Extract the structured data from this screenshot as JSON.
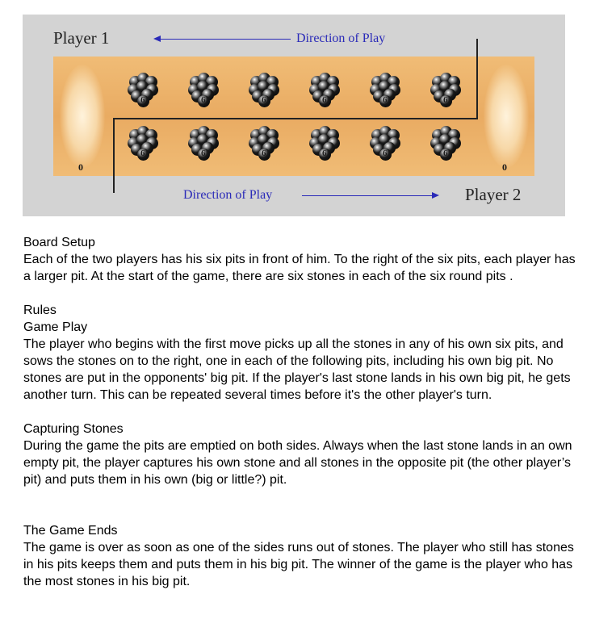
{
  "board": {
    "player1_label": "Player 1",
    "player2_label": "Player 2",
    "direction_top": "Direction of Play",
    "direction_bottom": "Direction of Play",
    "top_row_counts": [
      "6",
      "6",
      "6",
      "6",
      "6",
      "6"
    ],
    "bottom_row_counts": [
      "6",
      "6",
      "6",
      "6",
      "6",
      "6"
    ],
    "left_store_count": "0",
    "right_store_count": "0",
    "colors": {
      "panel": "#d3d3d3",
      "wood": "#e9ab62",
      "arrow": "#2a2ab8",
      "stone": "#000000"
    }
  },
  "rules": {
    "board_setup_title": "Board Setup",
    "board_setup_text": "Each of the two players has his six pits in front of him. To the right of the six pits, each player has a larger pit. At the start of the game, there are six stones in each of the six round pits .",
    "rules_title": "Rules",
    "game_play_title": "Game Play",
    "game_play_text": "The player who begins with the first move picks up all the stones in any of his own six pits, and sows the stones on to the right, one in each of the following pits, including his own big pit. No stones are put in the opponents' big pit. If the player's last stone lands in his own big pit, he gets another turn. This can be repeated several times before it's the other player's turn.",
    "capturing_title": "Capturing Stones",
    "capturing_text": "During the game the pits are emptied on both sides. Always when the last stone lands in an own empty pit, the player captures his own stone and all stones in the opposite pit (the other player’s pit) and puts them in his own (big or little?) pit.",
    "game_ends_title": "The Game Ends",
    "game_ends_text": "The game is over as soon as one of the sides runs out of stones. The player who still has stones in his pits keeps them and puts them in his big pit. The winner of the game is the player who has the most stones in his big pit."
  }
}
